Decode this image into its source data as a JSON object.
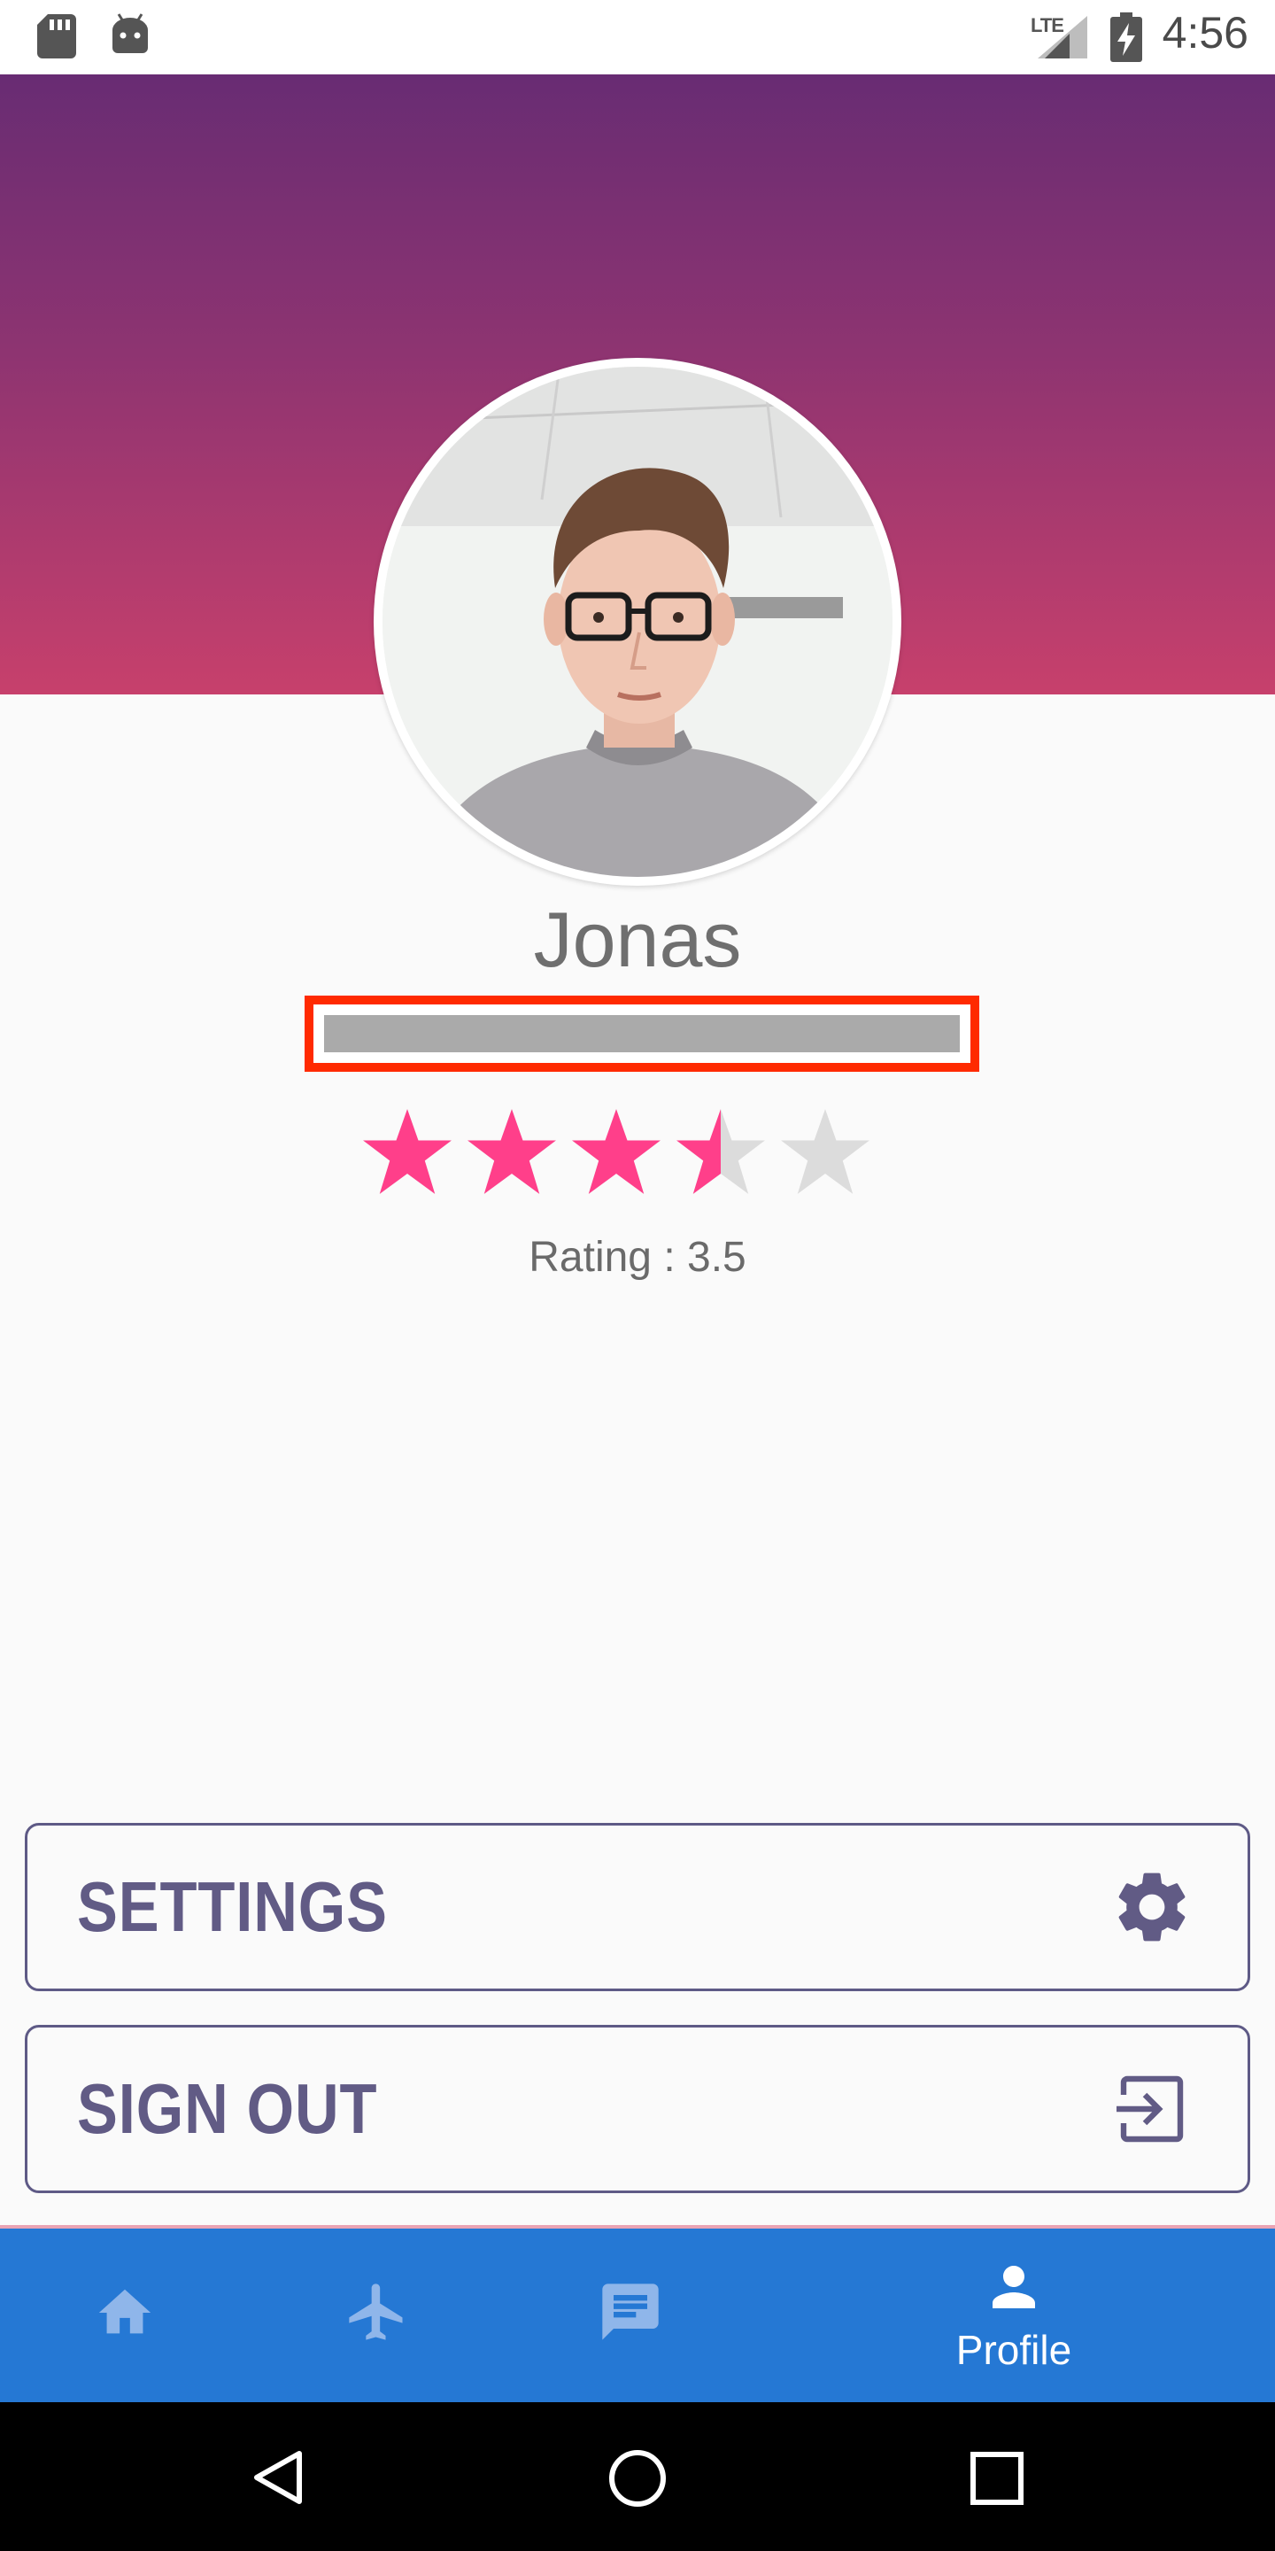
{
  "status_bar": {
    "time": "4:56",
    "network": "LTE",
    "icons": [
      "sd-card-icon",
      "android-icon",
      "signal-icon",
      "battery-charging-icon"
    ]
  },
  "profile": {
    "name": "Jonas",
    "email_redacted": true,
    "rating_label": "Rating : 3.5",
    "rating_value": 3.5,
    "rating_max": 5,
    "star_filled_color": "#ff3f8a",
    "star_empty_color": "#dcdcdc"
  },
  "actions": {
    "settings": {
      "label": "SETTINGS",
      "icon": "gear-icon"
    },
    "sign_out": {
      "label": "SIGN OUT",
      "icon": "exit-icon"
    }
  },
  "bottom_nav": {
    "items": [
      {
        "id": "home",
        "icon": "home-icon",
        "label": ""
      },
      {
        "id": "flights",
        "icon": "airplane-icon",
        "label": ""
      },
      {
        "id": "messages",
        "icon": "message-icon",
        "label": ""
      },
      {
        "id": "profile",
        "icon": "person-icon",
        "label": "Profile",
        "active": true
      }
    ],
    "background": "#2578d4"
  },
  "colors": {
    "header_gradient_top": "#682c73",
    "header_gradient_bottom": "#c7406c",
    "button_text": "#615b85"
  }
}
